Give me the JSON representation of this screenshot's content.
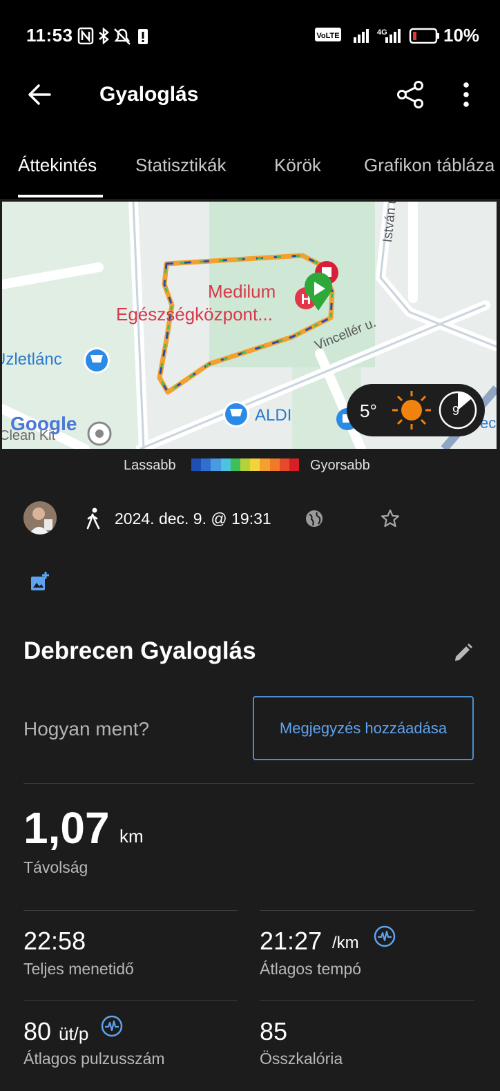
{
  "status_bar": {
    "time": "11:53",
    "battery_percent": "10%",
    "network": "4G",
    "volte": "VoLTE"
  },
  "app_bar": {
    "title": "Gyaloglás"
  },
  "tabs": [
    {
      "label": "Áttekintés",
      "active": true
    },
    {
      "label": "Statisztikák",
      "active": false
    },
    {
      "label": "Körök",
      "active": false
    },
    {
      "label": "Grafikon tábláza",
      "active": false
    }
  ],
  "map": {
    "labels": {
      "poi_name_1": "Medilum",
      "poi_name_2": "Egészségközpont...",
      "street_1": "István út",
      "street_2": "Vincellér u.",
      "store_1": "Üzletlánc",
      "store_2": "ALDI",
      "partial_1": "Clean Kit",
      "partial_2": "ec",
      "google": "Google"
    },
    "weather": {
      "temperature": "5°",
      "wind": "9"
    }
  },
  "legend": {
    "slow": "Lassabb",
    "fast": "Gyorsabb",
    "colors": [
      "#1f4fb4",
      "#2f6fd0",
      "#4a9ae0",
      "#4cc3e0",
      "#3fbf5a",
      "#b6d23a",
      "#f1d43a",
      "#f2a030",
      "#f07a25",
      "#e64a2a",
      "#d81f26"
    ]
  },
  "activity": {
    "datetime": "2024. dec. 9. @ 19:31",
    "name": "Debrecen Gyaloglás",
    "prompt": "Hogyan ment?",
    "note_button": "Megjegyzés hozzáadása"
  },
  "stats": {
    "distance": {
      "value": "1,07",
      "unit": "km",
      "label": "Távolság"
    },
    "total_time": {
      "value": "22:58",
      "label": "Teljes menetidő"
    },
    "avg_pace": {
      "value": "21:27",
      "unit": "/km",
      "label": "Átlagos tempó"
    },
    "avg_hr": {
      "value": "80",
      "unit": "üt/p",
      "label": "Átlagos pulzusszám"
    },
    "calories": {
      "value": "85",
      "label": "Összkalória"
    }
  },
  "colors": {
    "background": "#1c1c1c",
    "accent": "#5fa3f0",
    "bar": "#000000"
  }
}
